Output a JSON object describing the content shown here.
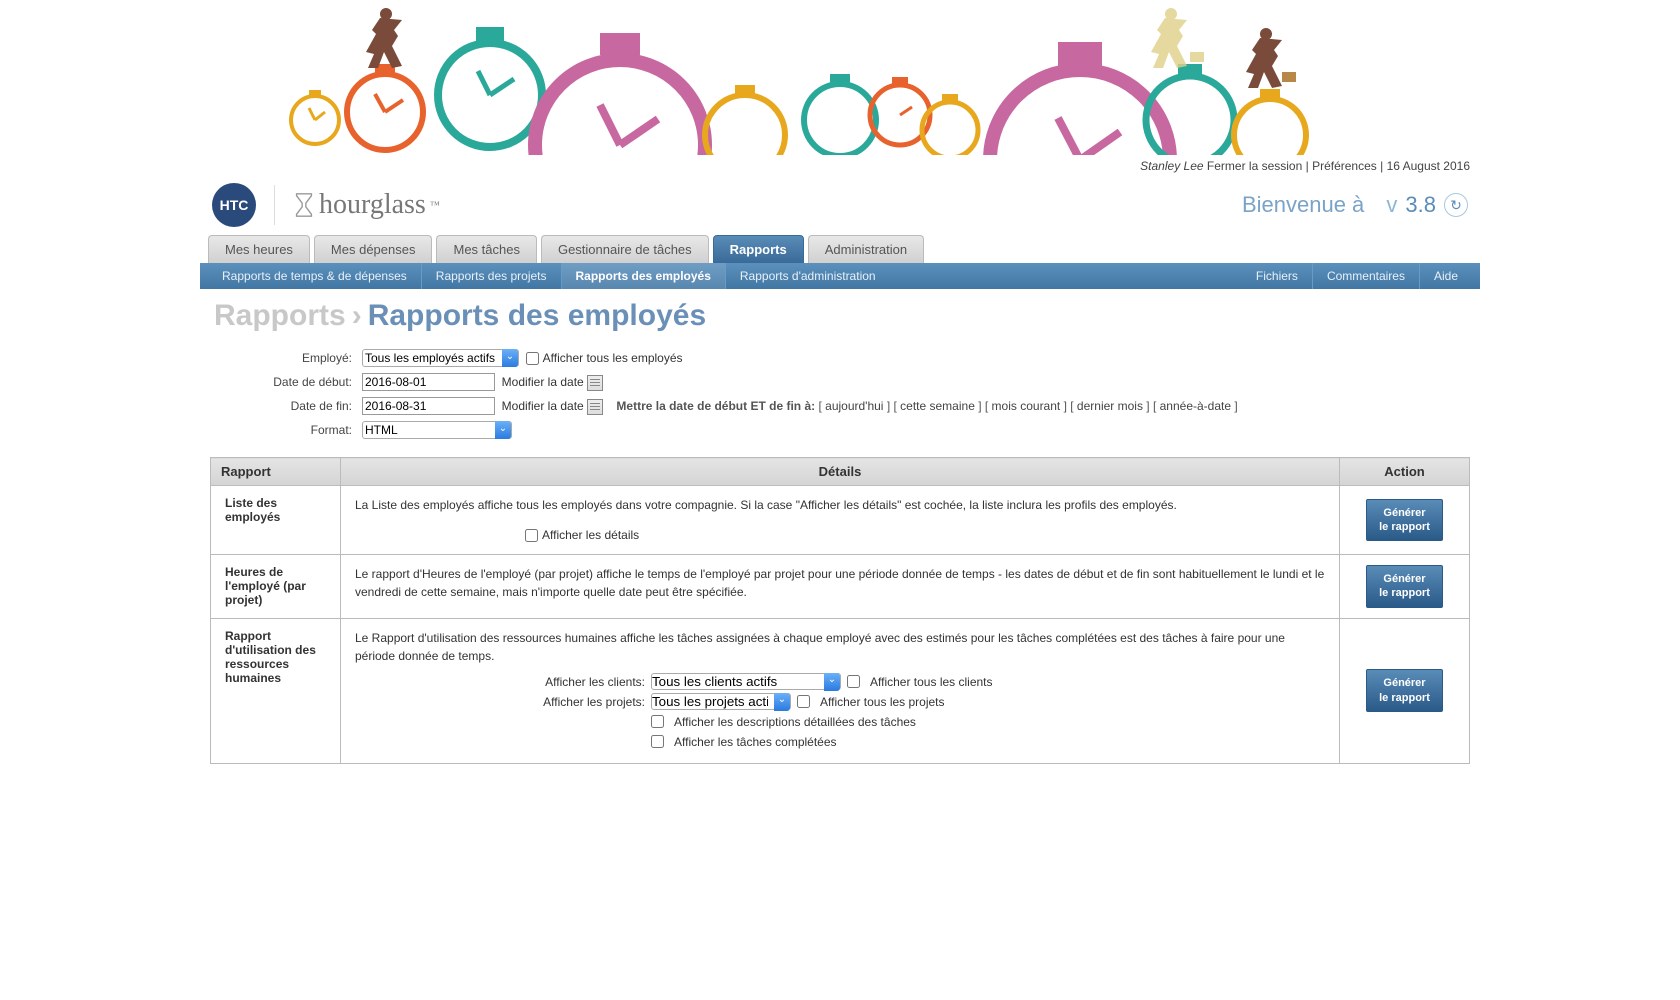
{
  "userbar": {
    "username": "Stanley Lee",
    "logout": "Fermer la session",
    "prefs": "Préférences",
    "date": "16 August 2016"
  },
  "brand": {
    "badge": "HTC",
    "name": "hourglass"
  },
  "welcome": {
    "text": "Bienvenue à",
    "v": "v",
    "ver": "3.8"
  },
  "tabs": [
    {
      "label": "Mes heures"
    },
    {
      "label": "Mes dépenses"
    },
    {
      "label": "Mes tâches"
    },
    {
      "label": "Gestionnaire de tâches"
    },
    {
      "label": "Rapports",
      "active": true
    },
    {
      "label": "Administration"
    }
  ],
  "subnav": {
    "left": [
      {
        "label": "Rapports de temps & de dépenses"
      },
      {
        "label": "Rapports des projets"
      },
      {
        "label": "Rapports des employés",
        "active": true
      },
      {
        "label": "Rapports d'administration"
      }
    ],
    "right": [
      {
        "label": "Fichiers"
      },
      {
        "label": "Commentaires"
      },
      {
        "label": "Aide"
      }
    ]
  },
  "crumb": {
    "root": "Rapports",
    "cur": "Rapports des employés"
  },
  "filters": {
    "employee_label": "Employé:",
    "employee_value": "Tous les employés actifs",
    "show_all_employees": "Afficher tous les employés",
    "start_label": "Date de début:",
    "start_value": "2016-08-01",
    "end_label": "Date de fin:",
    "end_value": "2016-08-31",
    "modify_date": "Modifier la date",
    "format_label": "Format:",
    "format_value": "HTML",
    "quick_prefix": "Mettre la date de début ET de fin à:",
    "quick": [
      "aujourd'hui",
      "cette semaine",
      "mois courant",
      "dernier mois",
      "année-à-date"
    ]
  },
  "grid": {
    "headers": {
      "rapport": "Rapport",
      "details": "Détails",
      "action": "Action"
    },
    "gen_button": "Générer\nle rapport",
    "rows": [
      {
        "name": "Liste des employés",
        "desc": "La Liste des employés affiche tous les employés dans votre compagnie. Si la case \"Afficher les détails\" est cochée, la liste inclura les profils des employés.",
        "sub_checkbox": "Afficher les détails"
      },
      {
        "name": "Heures de l'employé (par projet)",
        "desc": "Le rapport d'Heures de l'employé (par projet) affiche le temps de l'employé par projet pour une période donnée de temps - les dates de début et de fin sont habituellement le lundi et le vendredi de cette semaine, mais n'importe quelle date peut être spécifiée."
      },
      {
        "name": "Rapport d'utilisation des ressources humaines",
        "desc": "Le Rapport d'utilisation des ressources humaines affiche les tâches assignées à chaque employé avec des estimés pour les tâches complétées est des tâches à faire pour une période donnée de temps.",
        "sub_controls": {
          "clients_label": "Afficher les clients:",
          "clients_value": "Tous les clients actifs",
          "clients_all": "Afficher tous les clients",
          "projects_label": "Afficher les projets:",
          "projects_value": "Tous les projets actifs",
          "projects_all": "Afficher tous les projets",
          "cb1": "Afficher les descriptions détaillées des tâches",
          "cb2": "Afficher les tâches complétées"
        }
      }
    ]
  }
}
